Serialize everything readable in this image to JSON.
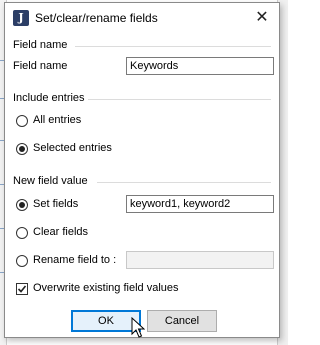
{
  "dialog": {
    "title": "Set/clear/rename fields",
    "icon": "jabref-icon",
    "close_glyph": "✕"
  },
  "field_name_group": {
    "title": "Field name",
    "label": "Field name",
    "value": "Keywords"
  },
  "include_entries_group": {
    "title": "Include entries",
    "options": [
      {
        "label": "All entries",
        "selected": false
      },
      {
        "label": "Selected entries",
        "selected": true
      }
    ]
  },
  "new_value_group": {
    "title": "New field value",
    "set_fields": {
      "label": "Set fields",
      "selected": true,
      "value": "keyword1, keyword2"
    },
    "clear_fields": {
      "label": "Clear fields",
      "selected": false
    },
    "rename_field": {
      "label": "Rename field to :",
      "selected": false,
      "value": ""
    },
    "overwrite": {
      "label": "Overwrite existing field values",
      "checked": true
    }
  },
  "buttons": {
    "ok": "OK",
    "cancel": "Cancel"
  }
}
